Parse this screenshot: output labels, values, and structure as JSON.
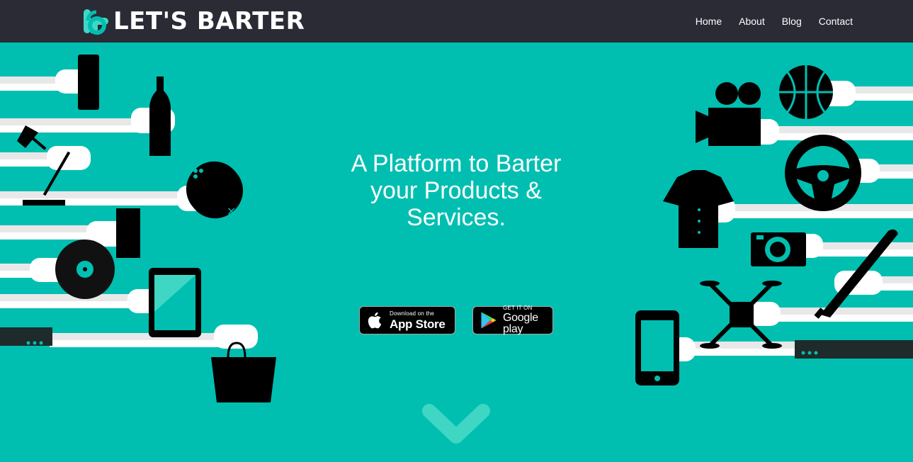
{
  "brand": {
    "name": "LET'S BARTER",
    "accent": "#00bfb1",
    "nav_bg": "#2a2b35"
  },
  "nav": {
    "items": [
      {
        "label": "Home"
      },
      {
        "label": "About"
      },
      {
        "label": "Blog"
      },
      {
        "label": "Contact"
      }
    ]
  },
  "hero": {
    "headline": "A Platform to Barter your Products & Services.",
    "illustration": {
      "left_items": [
        "phone-icon",
        "wine-bottle-icon",
        "desk-lamp-icon",
        "game-controller-icon",
        "ticket-icon",
        "vinyl-record-icon",
        "tablet-icon",
        "shopping-bag-icon"
      ],
      "right_items": [
        "basketball-icon",
        "movie-camera-icon",
        "steering-wheel-icon",
        "shirt-icon",
        "camera-icon",
        "baseball-bat-icon",
        "drone-icon",
        "smartphone-icon"
      ]
    },
    "app_store": {
      "small": "Download on the",
      "big": "App Store",
      "icon": "apple-icon"
    },
    "google_play": {
      "small": "GET IT ON",
      "big": "Google play",
      "icon": "play-triangle-icon"
    },
    "scroll_icon": "chevron-down-icon"
  }
}
